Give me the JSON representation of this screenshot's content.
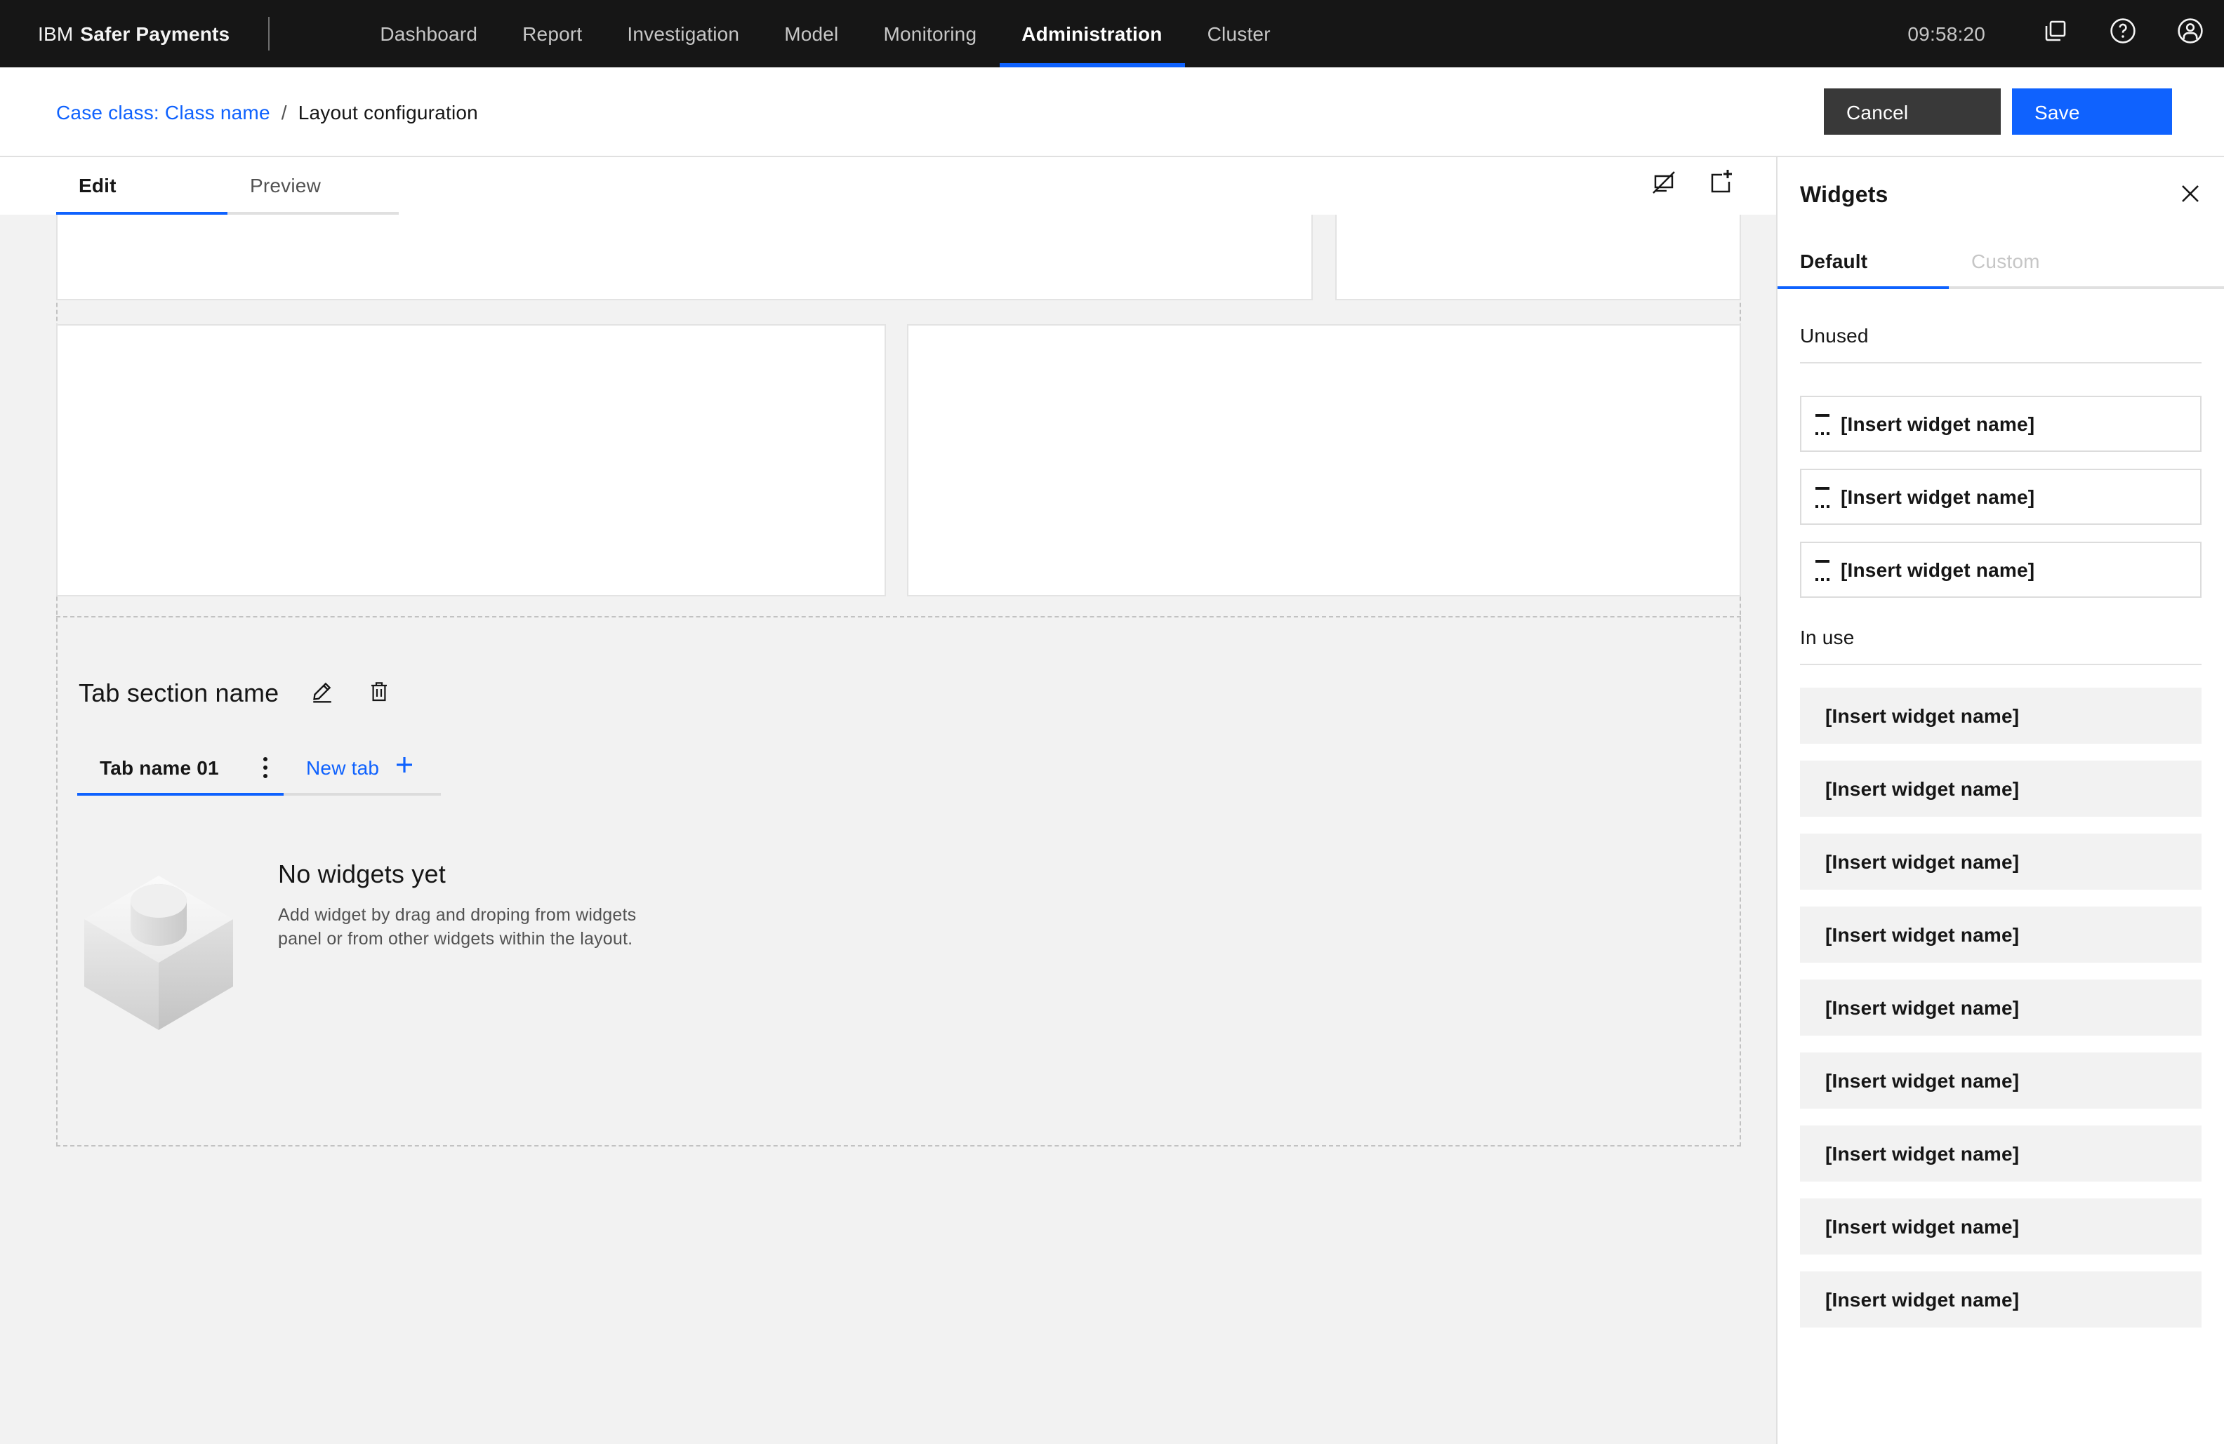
{
  "nav": {
    "brand_prefix": "IBM",
    "brand_name": "Safer Payments",
    "items": [
      {
        "label": "Dashboard",
        "active": false
      },
      {
        "label": "Report",
        "active": false
      },
      {
        "label": "Investigation",
        "active": false
      },
      {
        "label": "Model",
        "active": false
      },
      {
        "label": "Monitoring",
        "active": false
      },
      {
        "label": "Administration",
        "active": true
      },
      {
        "label": "Cluster",
        "active": false
      }
    ],
    "time": "09:58:20"
  },
  "page_header": {
    "breadcrumb_link": "Case class: Class name",
    "breadcrumb_separator": "/",
    "breadcrumb_current": "Layout configuration",
    "cancel_label": "Cancel",
    "save_label": "Save"
  },
  "editor": {
    "edit_tab": "Edit",
    "preview_tab": "Preview"
  },
  "section": {
    "title": "Tab section name",
    "current_tab_label": "Tab name 01",
    "new_tab_label": "New tab",
    "empty_title": "No widgets yet",
    "empty_description": "Add widget by drag and droping from widgets panel or from other widgets within the layout."
  },
  "widgets_panel": {
    "title": "Widgets",
    "default_tab": "Default",
    "custom_tab": "Custom",
    "unused_heading": "Unused",
    "in_use_heading": "In use",
    "unused_items": [
      "[Insert widget name]",
      "[Insert widget name]",
      "[Insert widget name]"
    ],
    "in_use_items": [
      "[Insert widget name]",
      "[Insert widget name]",
      "[Insert widget name]",
      "[Insert widget name]",
      "[Insert widget name]",
      "[Insert widget name]",
      "[Insert widget name]",
      "[Insert widget name]",
      "[Insert widget name]"
    ]
  },
  "colors": {
    "accent_blue": "#0f62fe",
    "nav_background": "#161616",
    "cancel_button": "#393939",
    "canvas_background": "#f2f2f2"
  }
}
